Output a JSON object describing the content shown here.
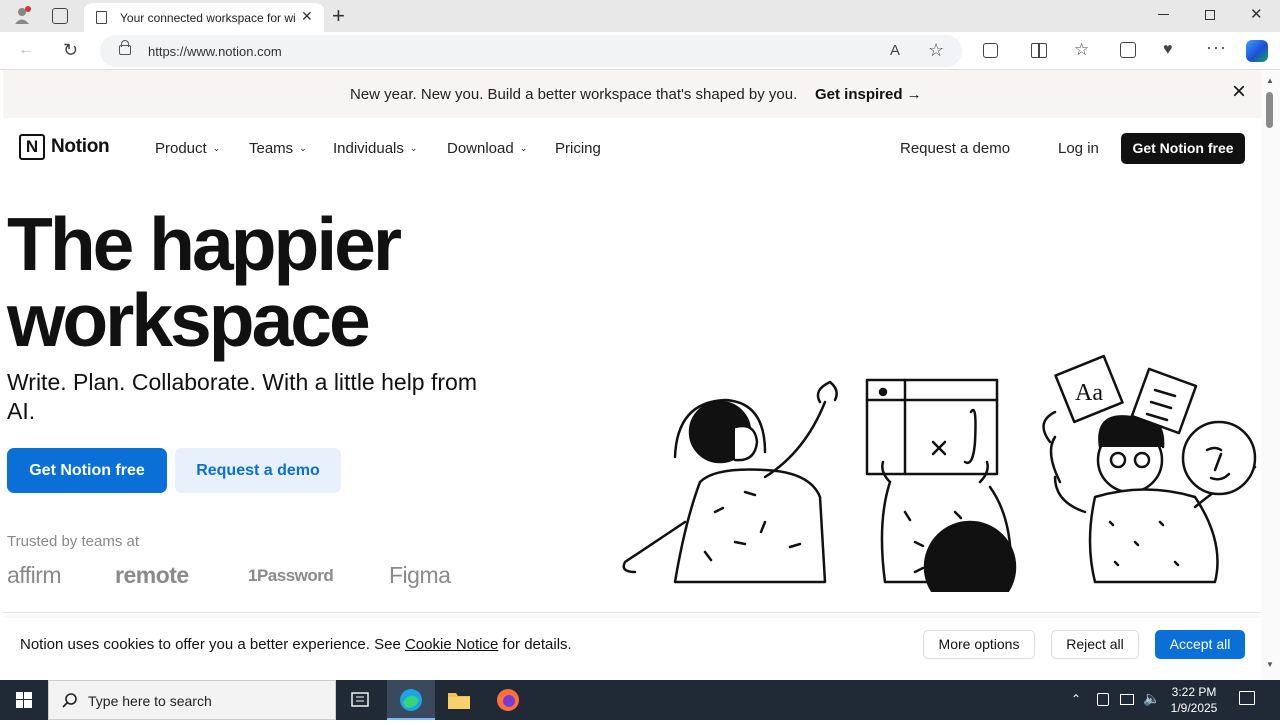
{
  "browser": {
    "tab_title": "Your connected workspace for wiki, docs & projects",
    "url": "https://www.notion.com",
    "read_aloud_label": "A"
  },
  "banner": {
    "text": "New year. New you. Build a better workspace that's shaped by you.",
    "link": "Get inspired →"
  },
  "nav": {
    "logo_mark": "N",
    "logo_text": "Notion",
    "items": [
      {
        "label": "Product",
        "has_menu": true
      },
      {
        "label": "Teams",
        "has_menu": true
      },
      {
        "label": "Individuals",
        "has_menu": true
      },
      {
        "label": "Download",
        "has_menu": true
      },
      {
        "label": "Pricing",
        "has_menu": false
      }
    ],
    "request_demo": "Request a demo",
    "login": "Log in",
    "cta": "Get Notion free"
  },
  "hero": {
    "title_line1": "The happier",
    "title_line2": "workspace",
    "subtitle": "Write. Plan. Collaborate. With a little help from AI.",
    "primary_button": "Get Notion free",
    "secondary_button": "Request a demo",
    "trusted_label": "Trusted by teams at",
    "brands": [
      "affirm",
      "remote",
      "1Password",
      "Figma"
    ]
  },
  "cookie": {
    "text_before": "Notion uses cookies to offer you a better experience. See ",
    "link": "Cookie Notice",
    "text_after": " for details.",
    "more_options": "More options",
    "reject_all": "Reject all",
    "accept_all": "Accept all"
  },
  "taskbar": {
    "search_placeholder": "Type here to search",
    "time": "3:22 PM",
    "date": "1/9/2025"
  },
  "colors": {
    "accent": "#0b6fd8",
    "taskbar": "#1f2a36"
  }
}
